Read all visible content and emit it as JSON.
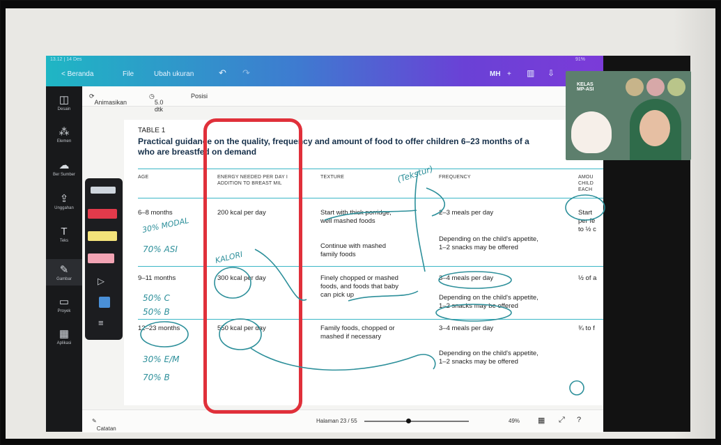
{
  "app": {
    "status_time": "13.12 | 14 Des",
    "status_right": "91%",
    "back_label": "< Beranda",
    "file_menu": "File",
    "resize_label": "Ubah ukuran",
    "user_initials": "MH",
    "present_label": "+"
  },
  "left_rail": [
    {
      "icon": "template-icon",
      "glyph": "◫",
      "label": "Desain"
    },
    {
      "icon": "elements-icon",
      "glyph": "⁂",
      "label": "Elemen"
    },
    {
      "icon": "upload-icon",
      "glyph": "☁",
      "label": "Ber Sumber"
    },
    {
      "icon": "cloud-upload-icon",
      "glyph": "⇪",
      "label": "Unggahan"
    },
    {
      "icon": "text-icon",
      "glyph": "T",
      "label": "Teks"
    },
    {
      "icon": "draw-icon",
      "glyph": "✎",
      "label": "Gambar"
    },
    {
      "icon": "folder-icon",
      "glyph": "▭",
      "label": "Proyek"
    },
    {
      "icon": "apps-icon",
      "glyph": "▦",
      "label": "Aplikasi"
    }
  ],
  "toolbar2": {
    "animate_label": "Animasikan",
    "time_label": "5.0 dtk",
    "position_label": "Posisi"
  },
  "doc": {
    "table_label": "TABLE 1",
    "title_line1": "Practical guidance on the quality, frequency and amount of food to offer children 6–23 months of a",
    "title_line2": "who are breastfed on demand",
    "headers": {
      "age": "AGE",
      "energy_line1": "ENERGY NEEDED PER DAY I",
      "energy_line2": "ADDITION TO BREAST MIL",
      "texture": "TEXTURE",
      "frequency": "FREQUENCY",
      "amount_line1": "AMOU",
      "amount_line2": "CHILD",
      "amount_line3": "EACH"
    },
    "rows": [
      {
        "age": "6–8 months",
        "energy": "200 kcal per day",
        "texture1_line1": "Start with thick porridge,",
        "texture1_line2": "well mashed foods",
        "texture2_line1": "Continue with mashed",
        "texture2_line2": "family foods",
        "freq1": "2–3 meals per day",
        "freq2_line1": "Depending on the child's appetite,",
        "freq2_line2": "1–2 snacks may be offered",
        "amount_line1": "Start",
        "amount_line2": "per fe",
        "amount_line3": "to ½ c"
      },
      {
        "age": "9–11 months",
        "energy": "300 kcal per day",
        "texture_line1": "Finely chopped or mashed",
        "texture_line2": "foods, and foods that baby",
        "texture_line3": "can pick up",
        "freq1": "3–4 meals per day",
        "freq2_line1": "Depending on the child's appetite,",
        "freq2_line2": "1–2 snacks may be offered",
        "amount": "½ of a"
      },
      {
        "age": "12–23 months",
        "energy": "550 kcal per day",
        "texture_line1": "Family foods, chopped or",
        "texture_line2": "mashed if necessary",
        "freq1": "3–4 meals per day",
        "freq2_line1": "Depending on the child's appetite,",
        "freq2_line2": "1–2 snacks may be offered",
        "amount": "¾ to f"
      }
    ]
  },
  "bottombar": {
    "notes_label": "Catatan",
    "page_label": "Halaman 23 / 55",
    "zoom_label": "49%",
    "page_progress": 0.42
  },
  "video": {
    "overlay_line1": "KELAS",
    "overlay_line2": "MP-ASI"
  },
  "annotations": {
    "texture_note": "(Tekstur)",
    "row1_note_a": "30% MODAL",
    "row1_note_b": "70% ASI",
    "kalori_note": "KALORI",
    "row2_note_a": "50% C",
    "row2_note_b": "50% B",
    "row3_note_a": "30% E/M",
    "row3_note_b": "70% B"
  },
  "colors": {
    "accent_cyan": "#39b6c6",
    "ink_teal": "#2c8f9a",
    "highlight_red": "#e0303a"
  }
}
